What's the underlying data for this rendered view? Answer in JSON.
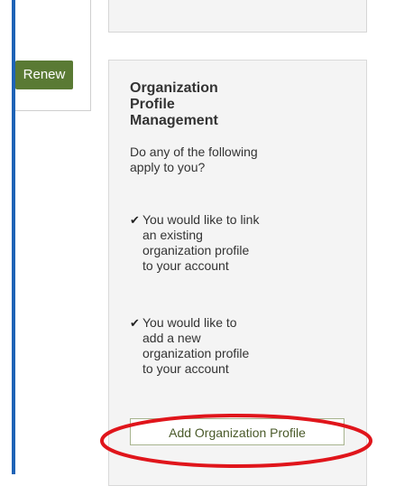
{
  "left_panel": {
    "renew_label": "Renew"
  },
  "org_card": {
    "title": "Organization Profile Management",
    "question": "Do any of the following apply to you?",
    "items": [
      {
        "icon": "check-icon",
        "text": "You would like to link an existing organization profile to your account"
      },
      {
        "icon": "check-icon",
        "text": "You would like to add a new organization profile to your account"
      }
    ],
    "add_button_label": "Add Organization Profile"
  },
  "colors": {
    "left_bar": "#1e63b6",
    "renew_button": "#5a7a34",
    "highlight_ellipse": "#e0151b"
  }
}
